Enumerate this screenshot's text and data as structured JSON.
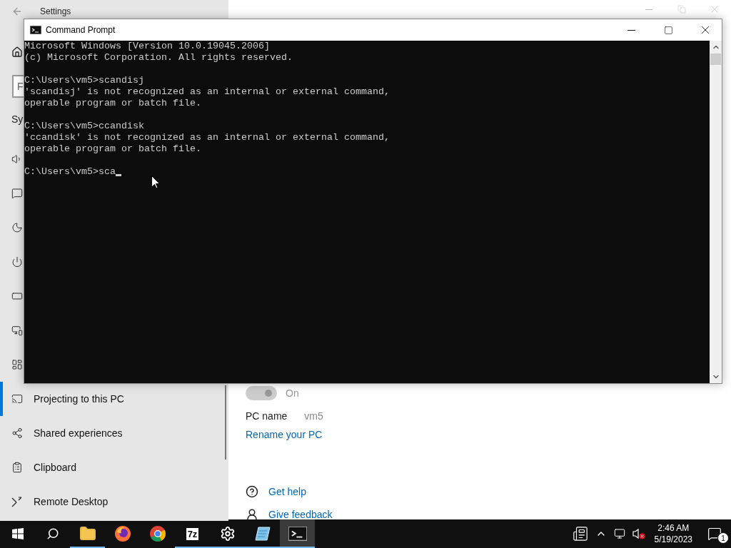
{
  "settings_window": {
    "title": "Settings",
    "search": {
      "placeholder": "F"
    },
    "section_heading": "Sy",
    "sidebar": {
      "items": [
        {
          "selected": false
        },
        {
          "selected": false
        },
        {
          "selected": false
        },
        {
          "selected": false
        },
        {
          "selected": false
        },
        {
          "selected": false
        },
        {
          "selected": false
        },
        {
          "label": "Projecting to this PC",
          "selected": true
        },
        {
          "label": "Shared experiences",
          "selected": false
        },
        {
          "label": "Clipboard",
          "selected": false
        },
        {
          "label": "Remote Desktop",
          "selected": false
        }
      ]
    },
    "toggle": {
      "label": "On",
      "on": true,
      "disabled": true
    },
    "pc_name": {
      "label": "PC name",
      "value": "vm5"
    },
    "rename_link": "Rename your PC",
    "help_links": [
      "Get help",
      "Give feedback"
    ]
  },
  "command_prompt": {
    "title": "Command Prompt",
    "blocks": [
      [
        "Microsoft Windows [Version 10.0.19045.2006]",
        "(c) Microsoft Corporation. All rights reserved."
      ],
      [
        "C:\\Users\\vm5>scandisj",
        "'scandisj' is not recognized as an internal or external command,",
        "operable program or batch file."
      ],
      [
        "C:\\Users\\vm5>ccandisk",
        "'ccandisk' is not recognized as an internal or external command,",
        "operable program or batch file."
      ],
      [
        "C:\\Users\\vm5>sca"
      ]
    ]
  },
  "taskbar": {
    "apps": [
      {
        "kind": "start",
        "running": false,
        "selected": false
      },
      {
        "kind": "search",
        "running": false,
        "selected": false
      },
      {
        "kind": "explorer",
        "running": true,
        "selected": false
      },
      {
        "kind": "firefox",
        "running": false,
        "selected": false
      },
      {
        "kind": "chrome",
        "running": false,
        "selected": false
      },
      {
        "kind": "archiver",
        "label": "7z",
        "running": true,
        "selected": false
      },
      {
        "kind": "settings",
        "running": true,
        "selected": false
      },
      {
        "kind": "notepad",
        "running": true,
        "selected": false
      },
      {
        "kind": "terminal",
        "running": true,
        "selected": true
      }
    ],
    "clock": {
      "time": "2:46 AM",
      "date": "5/19/2023"
    },
    "notifications": {
      "count": "1"
    }
  }
}
